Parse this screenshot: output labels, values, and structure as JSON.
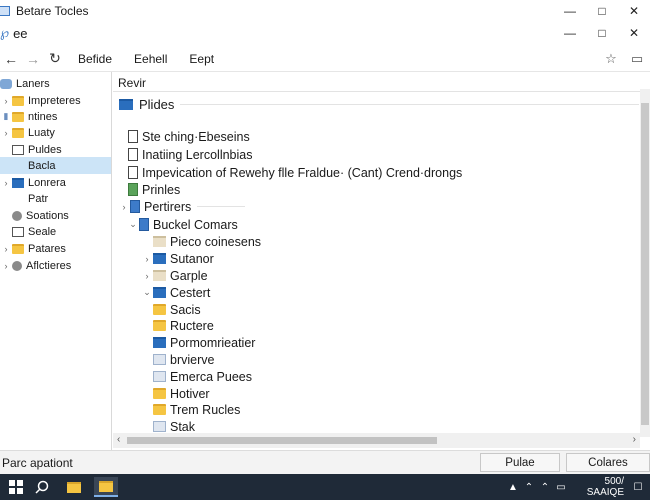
{
  "window": {
    "title": "Betare Tocles"
  },
  "address": {
    "text": "ee"
  },
  "toolbar": {
    "items": [
      "Befide",
      "Eehell",
      "Eept"
    ]
  },
  "sidebar": {
    "header": "Laners",
    "items": [
      "Impreteres",
      "ntines",
      "Luaty",
      "Puldes",
      "Bacla",
      "Lonrera",
      "Patr",
      "Soations",
      "Seale",
      "Patares",
      "Aflctieres"
    ]
  },
  "main": {
    "column_header": "Revir",
    "group_label": "Plides",
    "rows": [
      "Ste ching·Ebeseins",
      "Inatiing Lercollnbias",
      "Impevication of Rewehy flle Fraldue· (Cant) Crend·drongs",
      "Prinles",
      "Pertirers",
      "Buckel Comars",
      "Pieco coinesens",
      "Sutanor",
      "Garple",
      "Cestert",
      "Sacis",
      "Ructere",
      "Pormomrieatier",
      "brvierve",
      "Emerca Puees",
      "Hotiver",
      "Trem Rucles",
      "Stak"
    ]
  },
  "status": {
    "text": "Parc apationt",
    "button1": "Pulae",
    "button2": "Colares"
  },
  "taskbar": {
    "time": "500/",
    "date": "SAAIQE"
  },
  "colors": {
    "accent": "#cce4f7",
    "folder": "#f5c542",
    "folder_blue": "#2a6ebd",
    "taskbar": "#1f2a38"
  }
}
